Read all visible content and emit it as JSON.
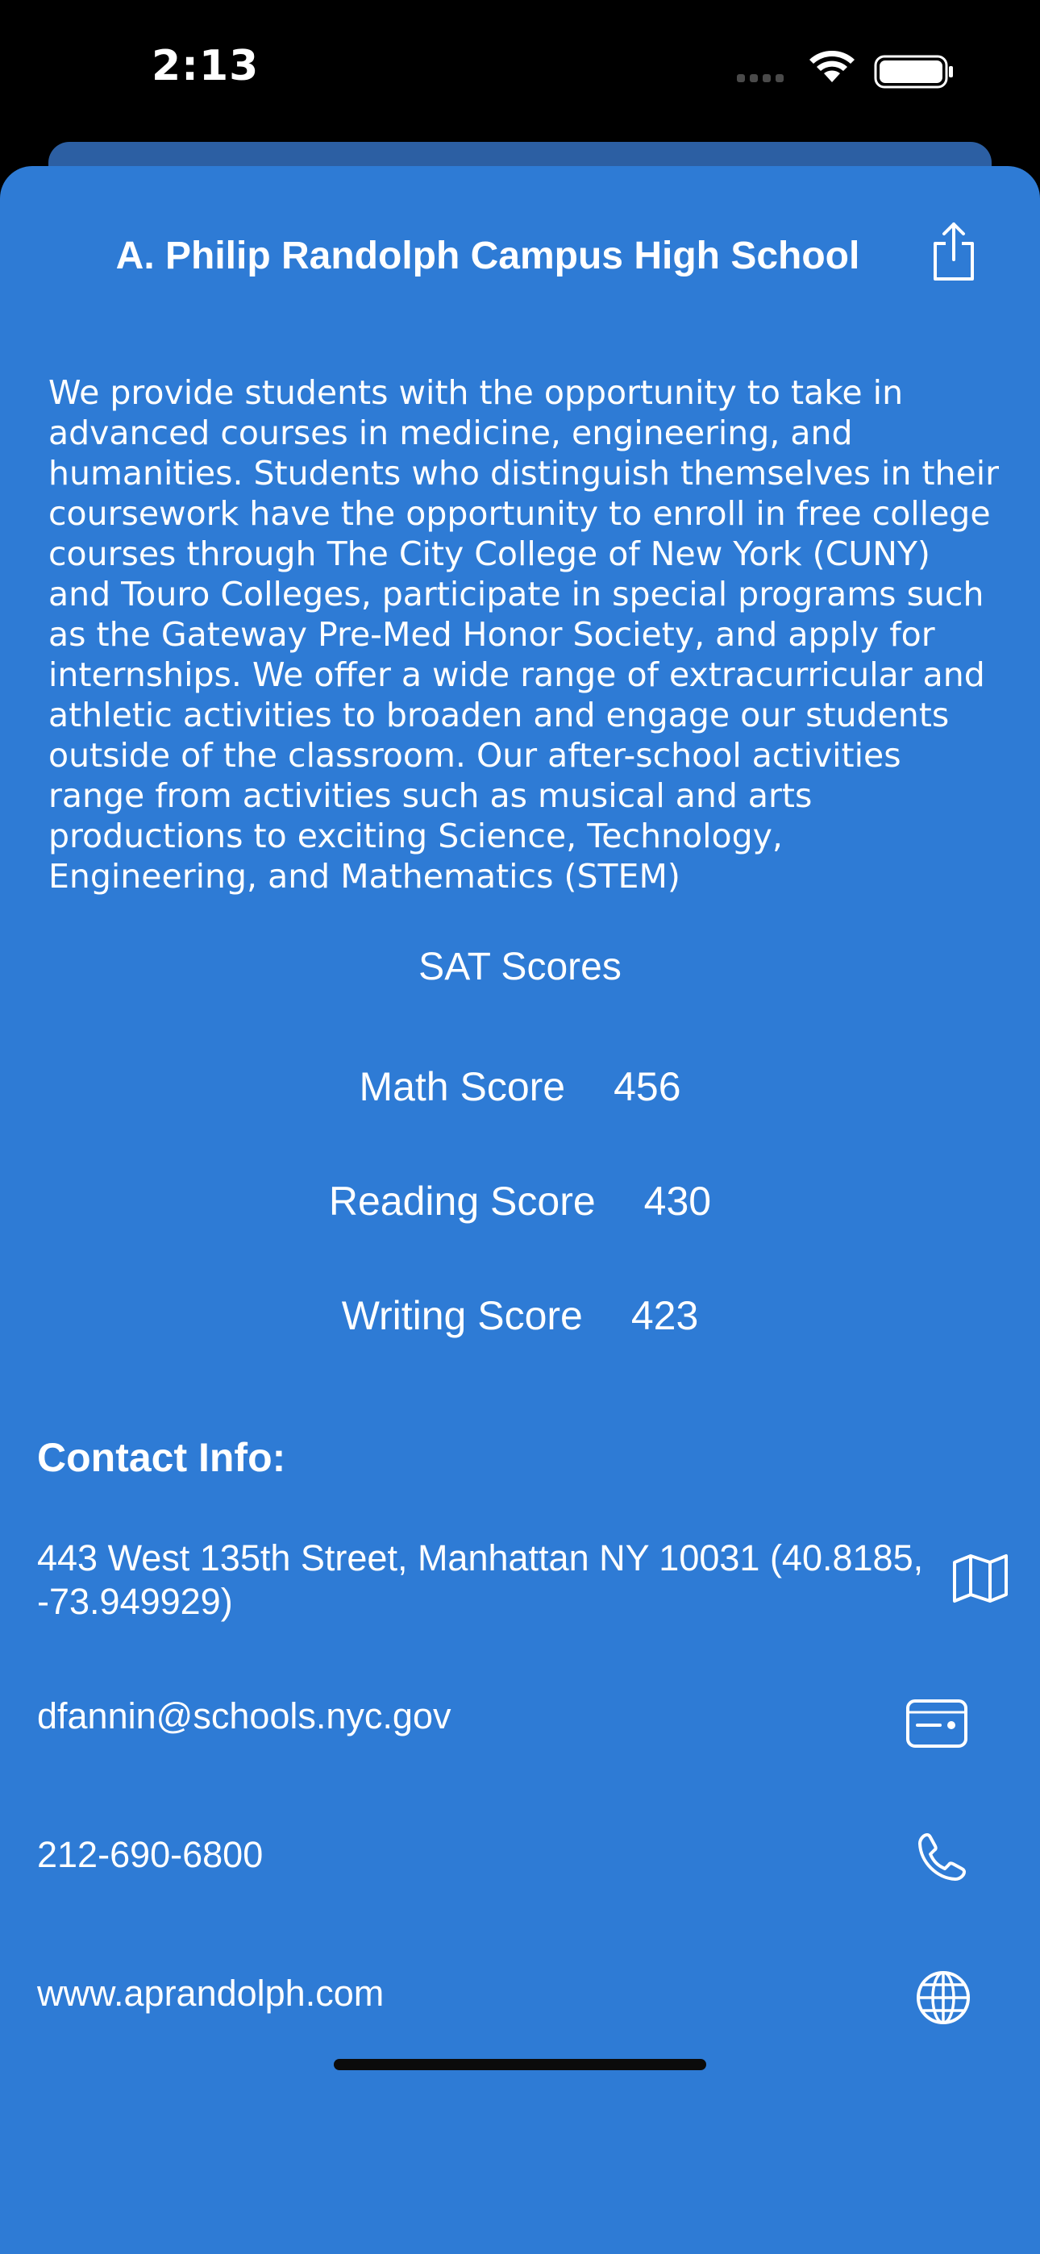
{
  "status_bar": {
    "time": "2:13"
  },
  "school": {
    "name": "A. Philip Randolph Campus High School",
    "overview": "We provide students with the opportunity to take in advanced courses in medicine, engineering, and humanities. Students who distinguish themselves in their coursework have the opportunity to enroll in free college courses through The City College of New York (CUNY) and Touro Colleges, participate in special programs such as the Gateway Pre-Med Honor Society, and apply for internships. We offer a wide range of extracurricular and athletic activities to broaden and engage our students outside of the classroom. Our after-school activities range from activities such as musical and arts productions to exciting Science, Technology, Engineering, and Mathematics (STEM)"
  },
  "sat": {
    "title": "SAT Scores",
    "rows": [
      {
        "label": "Math Score",
        "value": "456"
      },
      {
        "label": "Reading Score",
        "value": "430"
      },
      {
        "label": "Writing Score",
        "value": "423"
      }
    ]
  },
  "contact": {
    "title": "Contact Info:",
    "address": "443 West 135th Street, Manhattan NY 10031 (40.8185, -73.949929)",
    "email": "dfannin@schools.nyc.gov",
    "phone": "212-690-6800",
    "website": "www.aprandolph.com"
  },
  "icons": {
    "share": "share-icon",
    "address": "map-icon",
    "email": "contact-card-icon",
    "phone": "phone-icon",
    "website": "globe-icon"
  },
  "colors": {
    "sheet_background": "#2e7bd5",
    "back_card": "#2c5fa3",
    "text": "#ffffff",
    "screen_background": "#000000"
  }
}
